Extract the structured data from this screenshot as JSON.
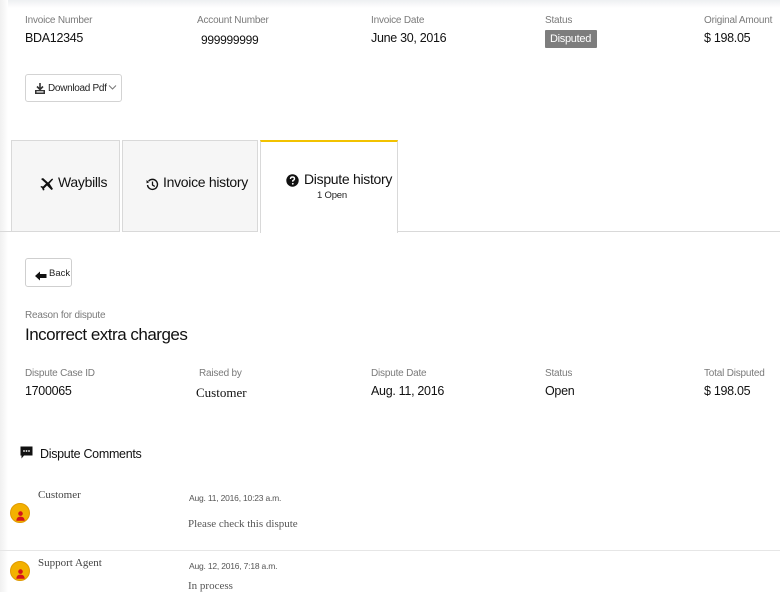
{
  "invoice_header": {
    "invoice_number_label": "Invoice Number",
    "invoice_number": "BDA12345",
    "account_number_label": "Account Number",
    "account_number": "999999999",
    "invoice_date_label": "Invoice Date",
    "invoice_date": "June 30, 2016",
    "status_label": "Status",
    "status": "Disputed",
    "original_amount_label": "Original Amount",
    "original_amount": "$ 198.05"
  },
  "download_button": {
    "label": "Download Pdf"
  },
  "tabs": [
    {
      "label": "Waybills",
      "icon": "plane-icon",
      "sub": ""
    },
    {
      "label": "Invoice history",
      "icon": "history-icon",
      "sub": ""
    },
    {
      "label": "Dispute history",
      "icon": "question-circle-icon",
      "sub": "1 Open"
    }
  ],
  "back_button": {
    "label": "Back"
  },
  "dispute": {
    "reason_label": "Reason for dispute",
    "reason": "Incorrect extra charges",
    "case_id_label": "Dispute Case ID",
    "case_id": "1700065",
    "raised_by_label": "Raised by",
    "raised_by": "Customer",
    "date_label": "Dispute Date",
    "date": "Aug. 11, 2016",
    "status_label": "Status",
    "status": "Open",
    "total_label": "Total Disputed",
    "total": "$ 198.05"
  },
  "comments": {
    "heading": "Dispute Comments",
    "items": [
      {
        "author": "Customer",
        "time": "Aug. 11, 2016, 10:23 a.m.",
        "text": "Please check this dispute"
      },
      {
        "author": "Support Agent",
        "time": "Aug. 12, 2016, 7:18 a.m.",
        "text": "In process"
      }
    ]
  },
  "colors": {
    "accent": "#f2c200",
    "badge": "#7d7d7d",
    "avatar": "#f3b100",
    "avatar_figure": "#d4131b"
  }
}
